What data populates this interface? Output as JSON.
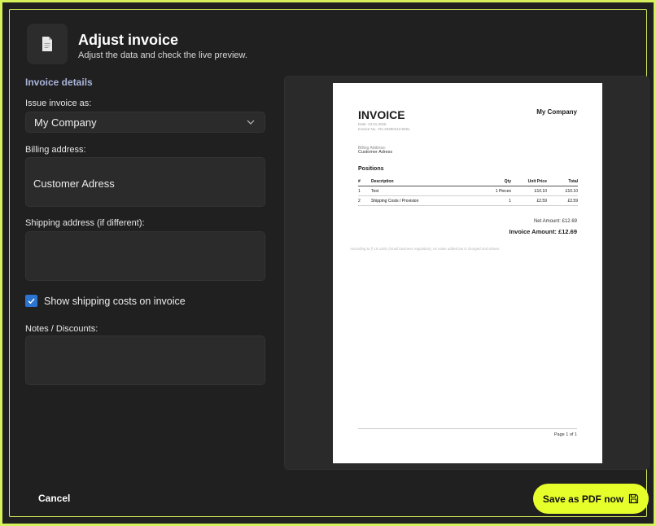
{
  "header": {
    "title": "Adjust invoice",
    "subtitle": "Adjust the data and check the live preview.",
    "icon": "document-icon"
  },
  "form": {
    "section_title": "Invoice details",
    "issue_as": {
      "label": "Issue invoice as:",
      "value": "My Company"
    },
    "billing": {
      "label": "Billing address:",
      "value": "Customer Adress"
    },
    "shipping": {
      "label": "Shipping address (if different):",
      "value": ""
    },
    "show_shipping": {
      "label": "Show shipping costs on invoice",
      "checked": true
    },
    "notes": {
      "label": "Notes / Discounts:",
      "value": ""
    }
  },
  "preview": {
    "title": "INVOICE",
    "company": "My Company",
    "date": "Date: 13.01.2026",
    "invoice_no": "Invoice No.: R1-20260113-9481",
    "billing_label": "Billing Address:",
    "billing_value": "Customer Adress",
    "positions_title": "Positions",
    "columns": [
      "#",
      "Description",
      "Qty",
      "Unit Price",
      "Total"
    ],
    "rows": [
      [
        "1",
        "Test",
        "1 Pieces",
        "£10.10",
        "£10.10"
      ],
      [
        "2",
        "Shipping Costs / Provision",
        "1",
        "£2.59",
        "£2.59"
      ]
    ],
    "net_amount": "Net Amount: £12.69",
    "invoice_amount": "Invoice Amount: £12.69",
    "note": "According to § 19 UStG (small business regulation), no value added tax is charged and shown.",
    "page": "Page 1 of 1"
  },
  "footer": {
    "cancel_label": "Cancel",
    "save_label": "Save as PDF now"
  },
  "colors": {
    "accent": "#e6ff2b",
    "border_accent": "#d6f25a",
    "checkbox": "#2b74d1",
    "section_title": "#aab4dc"
  }
}
